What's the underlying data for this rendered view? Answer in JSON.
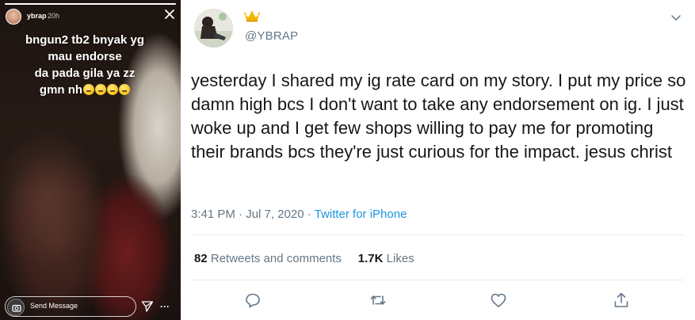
{
  "story": {
    "username": "ybrap",
    "time": "20h",
    "caption_lines": [
      "bngun2 tb2 bnyak yg",
      "mau endorse",
      "da pada gila ya zz",
      "gmn nh"
    ],
    "emoji_count": 4,
    "progress": 1.0,
    "send_message_placeholder": "Send Message",
    "icons": [
      "close-icon",
      "camera-icon",
      "direct-share-icon",
      "more-icon"
    ]
  },
  "tweet": {
    "handle": "@YBRAP",
    "text": "yesterday I shared my ig rate card on my story. I put my price so damn high bcs I don't want to take any endorsement on ig. I just woke up and I get few shops willing to pay me for promoting their brands bcs they're just curious for the impact. jesus christ",
    "time": "3:41 PM",
    "separator": "·",
    "date": "Jul 7, 2020",
    "source": "Twitter for iPhone",
    "retweets_count": "82",
    "retweets_label": "Retweets and comments",
    "likes_count": "1.7K",
    "likes_label": "Likes",
    "icons": [
      "crown-icon",
      "chevron-down-icon",
      "reply-icon",
      "retweet-icon",
      "like-icon",
      "share-icon"
    ]
  },
  "colors": {
    "text_primary": "#14171a",
    "text_secondary": "#657786",
    "link": "#1b95e0",
    "divider": "#e6ecf0",
    "crown": "#f5b400"
  }
}
